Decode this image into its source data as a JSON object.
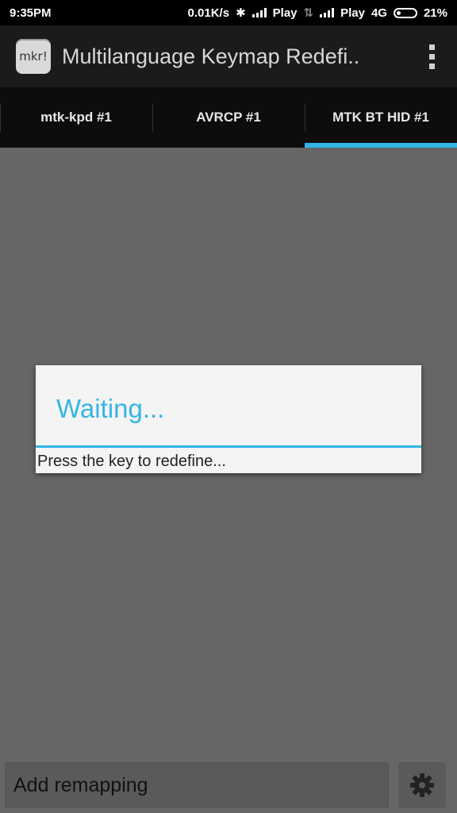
{
  "status_bar": {
    "time": "9:35PM",
    "speed": "0.01K/s",
    "carrier1": "Play",
    "carrier2": "Play",
    "network": "4G",
    "battery": "21%"
  },
  "action_bar": {
    "app_icon_text": "mkr!",
    "title": "Multilanguage Keymap Redefi.."
  },
  "tabs": [
    {
      "label": "mtk-kpd #1",
      "selected": false
    },
    {
      "label": "AVRCP #1",
      "selected": false
    },
    {
      "label": "MTK BT HID #1",
      "selected": true
    }
  ],
  "dialog": {
    "title": "Waiting...",
    "message": "Press the key to redefine..."
  },
  "bottom": {
    "add_label": "Add remapping",
    "settings_icon": "gear-icon"
  },
  "colors": {
    "accent": "#33b5e5",
    "dim_background": "#666666"
  }
}
